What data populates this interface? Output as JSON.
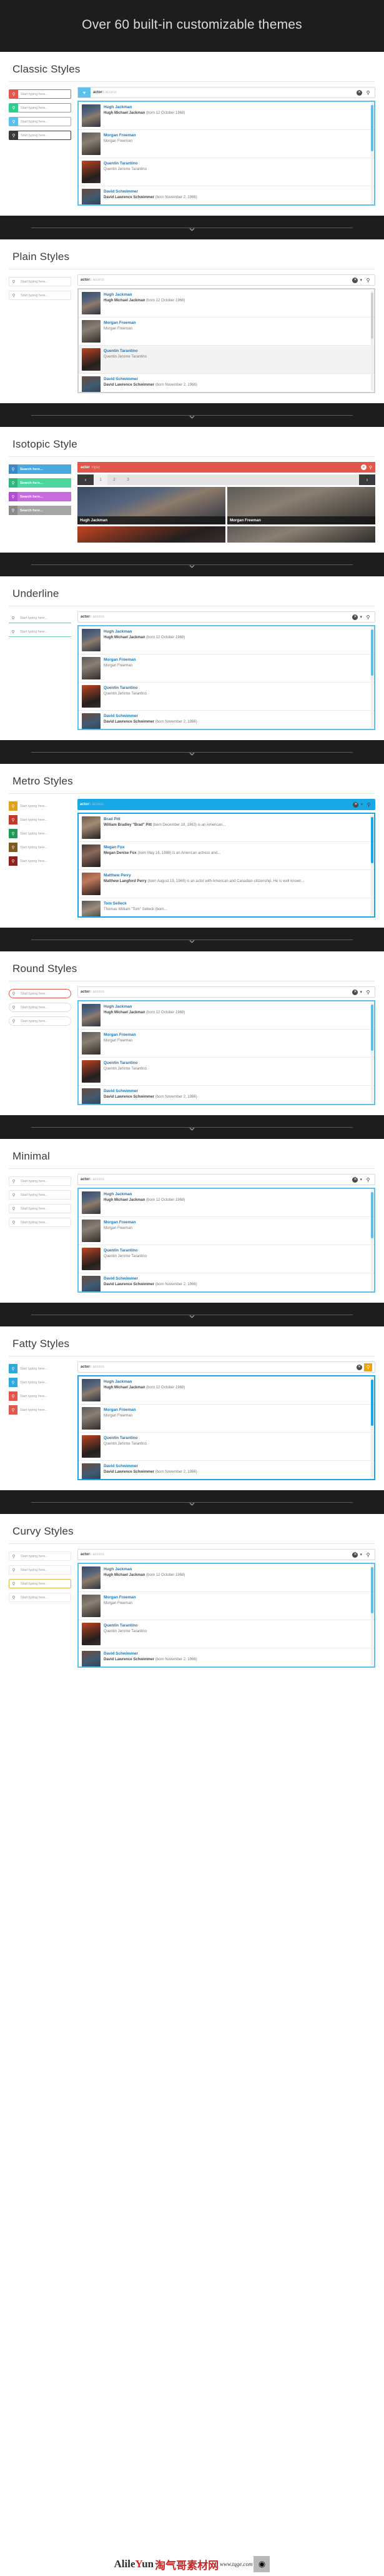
{
  "hero": {
    "title": "Over 60 built-in customizable themes"
  },
  "common": {
    "placeholder_typing": "Start typing here...",
    "placeholder_search": "Search here...",
    "query_bold": "actor",
    "query_ghost": "s access",
    "iso_ghost": "vijjay",
    "clear_icon": "close-circle-icon",
    "search_icon": "search-icon",
    "caret_icon": "chevron-down-icon",
    "prev_icon": "chevron-left-icon",
    "next_icon": "chevron-right-icon"
  },
  "results": {
    "default": [
      {
        "name": "Hugh Jackman",
        "desc_bold": "Hugh Michael Jackman",
        "desc": " (born 12 October 1968)"
      },
      {
        "name": "Morgan Freeman",
        "desc_bold": "",
        "desc": "Morgan Freeman"
      },
      {
        "name": "Quentin Tarantino",
        "desc_bold": "",
        "desc": "Quentin Jerome Tarantino"
      },
      {
        "name": "David Schwimmer",
        "desc_bold": "David Lawrence Schwimmer",
        "desc": " (born November 2, 1966)"
      }
    ],
    "metro": [
      {
        "name": "Brad Pitt",
        "desc_bold": "William Bradley \"Brad\" Pitt",
        "desc": " (born December 18, 1963) is an American..."
      },
      {
        "name": "Megan Fox",
        "desc_bold": "Megan Denise Fox",
        "desc": " (born May 16, 1986) is an American actress and..."
      },
      {
        "name": "Matthew Perry",
        "desc_bold": "Matthew Langford Perry",
        "desc": " (born August 19, 1969) is an actor with American and Canadian citizenship. He is well known..."
      },
      {
        "name": "Tom Selleck",
        "desc_bold": "",
        "desc": "Thomas William \"Tom\" Selleck (born..."
      }
    ]
  },
  "sections": [
    {
      "title": "Classic Styles",
      "accent": "#5bc0eb",
      "inputs": [
        {
          "style": "v-classic",
          "icon_bg": "#e2574c",
          "border": "#e2574c",
          "placeholder": "Start typing here..."
        },
        {
          "style": "v-classic",
          "icon_bg": "#2ecc8f",
          "border": "#2ecc8f",
          "placeholder": "Start typing here..."
        },
        {
          "style": "v-classic",
          "icon_bg": "#5bc0eb",
          "border": "#5bc0eb",
          "placeholder": "Start typing here..."
        },
        {
          "style": "v-classic",
          "icon_bg": "#3a3a3a",
          "border": "#3a3a3a",
          "placeholder": "Start typing here..."
        }
      ]
    },
    {
      "title": "Plain Styles",
      "accent": "#cfcfcf",
      "selected_index": 2,
      "inputs": [
        {
          "style": "v-plain",
          "icon_bg": "#ffffff",
          "border": "#e2e2e2",
          "placeholder": "Start typing here..."
        },
        {
          "style": "v-plain",
          "icon_bg": "#ffffff",
          "border": "#e2e2e2",
          "placeholder": "Start typing here..."
        }
      ]
    },
    {
      "title": "Isotopic Style",
      "accent": "#e2574c",
      "pages": [
        "1",
        "2",
        "3"
      ],
      "inputs": [
        {
          "style": "v-iso",
          "icon_bg": "#3a89c9",
          "border": "#4aa8e0",
          "placeholder": "Search here..."
        },
        {
          "style": "v-iso",
          "icon_bg": "#2eb67d",
          "border": "#4cd6a0",
          "placeholder": "Search here..."
        },
        {
          "style": "v-iso",
          "icon_bg": "#b44bd6",
          "border": "#c86ae0",
          "placeholder": "Search here..."
        },
        {
          "style": "v-iso",
          "icon_bg": "#8a8a8a",
          "border": "#a5a5a5",
          "placeholder": "Search here..."
        }
      ]
    },
    {
      "title": "Underline",
      "accent": "#5bc0eb",
      "inputs": [
        {
          "style": "v-line",
          "icon_bg": "#ffffff",
          "border": "#8fb9ad",
          "placeholder": "Start typing here..."
        },
        {
          "style": "v-line",
          "icon_bg": "#ffffff",
          "border": "#6fc8a0",
          "placeholder": "Start typing here..."
        }
      ]
    },
    {
      "title": "Metro Styles",
      "accent": "#18a8e8",
      "inputs": [
        {
          "style": "v-metro",
          "icon_bg": "#e0a020",
          "border": "#f0b030",
          "placeholder": "Start typing here..."
        },
        {
          "style": "v-metro",
          "icon_bg": "#c0392b",
          "border": "#d4483a",
          "placeholder": "Start typing here..."
        },
        {
          "style": "v-metro",
          "icon_bg": "#229954",
          "border": "#2eb56a",
          "placeholder": "Start typing here..."
        },
        {
          "style": "v-metro",
          "icon_bg": "#7d5a1f",
          "border": "#8f6a2a",
          "placeholder": "Start typing here..."
        },
        {
          "style": "v-metro",
          "icon_bg": "#8e1f1f",
          "border": "#a52a2a",
          "placeholder": "Start typing here..."
        }
      ]
    },
    {
      "title": "Round Styles",
      "accent": "#5bc0eb",
      "inputs": [
        {
          "style": "v-round",
          "icon_bg": "#ffffff",
          "border": "#e2574c",
          "placeholder": "Start typing here..."
        },
        {
          "style": "v-round",
          "icon_bg": "#ffffff",
          "border": "#dddddd",
          "placeholder": "Start typing here..."
        },
        {
          "style": "v-round",
          "icon_bg": "#ffffff",
          "border": "#dddddd",
          "placeholder": "Start typing here..."
        }
      ]
    },
    {
      "title": "Minimal",
      "accent": "#5bc0eb",
      "inputs": [
        {
          "style": "v-min",
          "icon_bg": "#ffffff",
          "border": "#e4e4e4",
          "placeholder": "Start typing here..."
        },
        {
          "style": "v-min",
          "icon_bg": "#ffffff",
          "border": "#e4e4e4",
          "placeholder": "Start typing here..."
        },
        {
          "style": "v-min",
          "icon_bg": "#ffffff",
          "border": "#e4e4e4",
          "placeholder": "Start typing here..."
        },
        {
          "style": "v-min",
          "icon_bg": "#ffffff",
          "border": "#e4e4e4",
          "placeholder": "Start typing here..."
        }
      ]
    },
    {
      "title": "Fatty Styles",
      "accent": "#18a8e8",
      "inputs": [
        {
          "style": "v-fat",
          "icon_bg": "#2fa8dd",
          "border": "#2fa8dd",
          "placeholder": "Start typing here..."
        },
        {
          "style": "v-fat",
          "icon_bg": "#2fa8dd",
          "border": "#2fa8dd",
          "placeholder": "Start typing here..."
        },
        {
          "style": "v-fat",
          "icon_bg": "#e2574c",
          "border": "#e2574c",
          "placeholder": "Start typing here..."
        },
        {
          "style": "v-fat",
          "icon_bg": "#e2574c",
          "border": "#e2574c",
          "placeholder": "Start typing here..."
        }
      ]
    },
    {
      "title": "Curvy Styles",
      "accent": "#5bc0eb",
      "inputs": [
        {
          "style": "v-curv",
          "icon_bg": "#ffffff",
          "border": "#e8e8e8",
          "placeholder": "Start typing here..."
        },
        {
          "style": "v-curv",
          "icon_bg": "#ffffff",
          "border": "#e8e8e8",
          "placeholder": "Start typing here..."
        },
        {
          "style": "v-curv",
          "icon_bg": "#ffffff",
          "border": "#d8b84a",
          "placeholder": "Start typing here..."
        },
        {
          "style": "v-curv",
          "icon_bg": "#ffffff",
          "border": "#e8e8e8",
          "placeholder": "Start typing here..."
        }
      ]
    }
  ],
  "isotopic_cards": [
    {
      "name": "Hugh Jackman"
    },
    {
      "name": "Morgan Freeman"
    }
  ],
  "watermark": {
    "brand": "Alile",
    "brand_accent": "Y",
    "brand_tail": "un",
    "cn": "淘气哥素材网",
    "url": "www.tqge.com"
  }
}
